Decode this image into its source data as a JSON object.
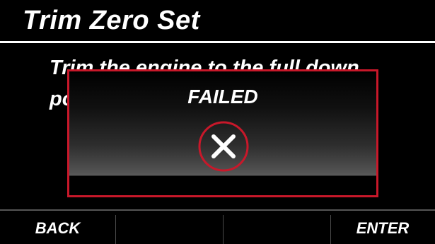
{
  "header": {
    "title": "Trim Zero Set"
  },
  "instruction": {
    "line1": "Trim the engine to the full down",
    "line2": "po"
  },
  "dialog": {
    "status": "FAILED",
    "icon": "fail-x-icon",
    "border_color": "#c8182a"
  },
  "softkeys": [
    {
      "label": "BACK"
    },
    {
      "label": ""
    },
    {
      "label": ""
    },
    {
      "label": "ENTER"
    }
  ]
}
